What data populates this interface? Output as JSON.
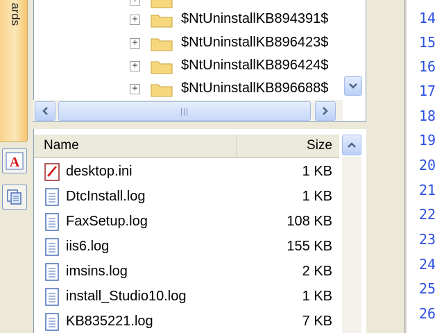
{
  "left_strip": {
    "tab_label": "ards",
    "buttons": [
      {
        "icon": "red-a-icon"
      },
      {
        "icon": "documents-icon"
      }
    ]
  },
  "tree": {
    "items": [
      {
        "label": "$NtUninstallKB894391$",
        "expander": "+"
      },
      {
        "label": "$NtUninstallKB896423$",
        "expander": "+"
      },
      {
        "label": "$NtUninstallKB896424$",
        "expander": "+"
      },
      {
        "label": "$NtUninstallKB896688$",
        "expander": "+"
      }
    ],
    "hscroll_grip": "|||"
  },
  "file_list": {
    "columns": {
      "name": "Name",
      "size": "Size"
    },
    "rows": [
      {
        "name": "desktop.ini",
        "size": "1 KB",
        "icon": "ini-file-icon"
      },
      {
        "name": "DtcInstall.log",
        "size": "1 KB",
        "icon": "text-file-icon"
      },
      {
        "name": "FaxSetup.log",
        "size": "108 KB",
        "icon": "text-file-icon"
      },
      {
        "name": "iis6.log",
        "size": "155 KB",
        "icon": "text-file-icon"
      },
      {
        "name": "imsins.log",
        "size": "2 KB",
        "icon": "text-file-icon"
      },
      {
        "name": "install_Studio10.log",
        "size": "1 KB",
        "icon": "text-file-icon"
      },
      {
        "name": "KB835221.log",
        "size": "7 KB",
        "icon": "text-file-icon"
      }
    ]
  },
  "editor": {
    "line_numbers": [
      "14",
      "15",
      "16",
      "17",
      "18",
      "19",
      "20",
      "21",
      "22",
      "23",
      "24",
      "25",
      "26"
    ]
  },
  "colors": {
    "line_number": "#2B4FE3",
    "tab_orange": "#F9D38B",
    "scroll_blue": "#BBD0F7"
  }
}
